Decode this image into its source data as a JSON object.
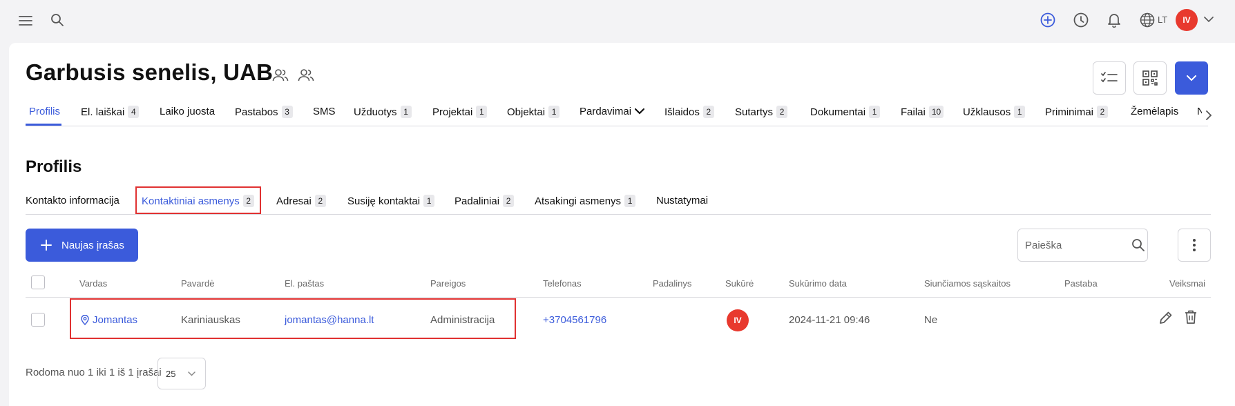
{
  "topbar": {
    "icons": [
      "menu-icon",
      "search-icon",
      "add-circle-icon",
      "clock-icon",
      "bell-icon",
      "globe-icon",
      "chevron-down-icon"
    ],
    "language": "LT",
    "user_initials": "IV",
    "accent_color": "#3b5bdb",
    "avatar_color": "#e8392e"
  },
  "company": {
    "title": "Garbusis senelis, UAB"
  },
  "tabs": [
    {
      "label": "Profilis",
      "badge": "",
      "active": true
    },
    {
      "label": "El. laiškai",
      "badge": "4"
    },
    {
      "label": "Laiko juosta",
      "badge": ""
    },
    {
      "label": "Pastabos",
      "badge": "3"
    },
    {
      "label": "SMS",
      "badge": ""
    },
    {
      "label": "Užduotys",
      "badge": "1"
    },
    {
      "label": "Projektai",
      "badge": "1"
    },
    {
      "label": "Objektai",
      "badge": "1"
    },
    {
      "label": "Pardavimai",
      "badge": ""
    },
    {
      "label": "Išlaidos",
      "badge": "2"
    },
    {
      "label": "Sutartys",
      "badge": "2"
    },
    {
      "label": "Dokumentai",
      "badge": "1"
    },
    {
      "label": "Failai",
      "badge": "10"
    },
    {
      "label": "Užklausos",
      "badge": "1"
    },
    {
      "label": "Priminimai",
      "badge": "2"
    },
    {
      "label": "Žemėlapis",
      "badge": ""
    },
    {
      "label": "N",
      "badge": ""
    }
  ],
  "section": {
    "title": "Profilis"
  },
  "subtabs": [
    {
      "label": "Kontakto informacija",
      "badge": ""
    },
    {
      "label": "Kontaktiniai asmenys",
      "badge": "2",
      "active": true
    },
    {
      "label": "Adresai",
      "badge": "2"
    },
    {
      "label": "Susiję kontaktai",
      "badge": "1"
    },
    {
      "label": "Padaliniai",
      "badge": "2"
    },
    {
      "label": "Atsakingi asmenys",
      "badge": "1"
    },
    {
      "label": "Nustatymai",
      "badge": ""
    }
  ],
  "toolbar": {
    "new_record_label": "Naujas įrašas",
    "search_placeholder": "Paieška"
  },
  "table": {
    "columns": [
      "Vardas",
      "Pavardė",
      "El. paštas",
      "Pareigos",
      "Telefonas",
      "Padalinys",
      "Sukūrė",
      "Sukūrimo data",
      "Siunčiamos sąskaitos",
      "Pastaba",
      "Veiksmai"
    ],
    "rows": [
      {
        "vardas": "Jomantas",
        "pavarde": "Kariniauskas",
        "email": "jomantas@hanna.lt",
        "pareigos": "Administracija",
        "telefonas": "+3704561796",
        "padalinys": "",
        "sukure": "IV",
        "sukurimo_data": "2024-11-21 09:46",
        "siunciamos": "Ne",
        "pastaba": ""
      }
    ]
  },
  "footer": {
    "summary": "Rodoma nuo 1 iki 1 iš 1 įrašai",
    "page_size": "25"
  }
}
